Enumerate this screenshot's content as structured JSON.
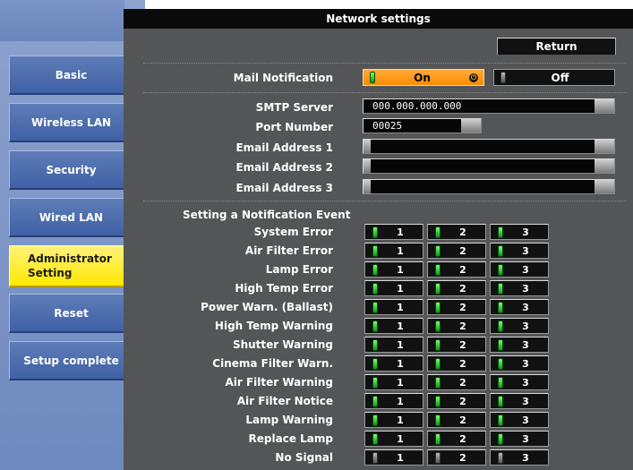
{
  "window": {
    "title": "Network settings"
  },
  "sidebar": {
    "items": [
      {
        "label": "Basic"
      },
      {
        "label": "Wireless LAN"
      },
      {
        "label": "Security"
      },
      {
        "label": "Wired LAN"
      },
      {
        "label": "Administrator Setting",
        "line1": "Administrator",
        "line2": "Setting",
        "active": true
      },
      {
        "label": "Reset"
      },
      {
        "label": "Setup complete"
      }
    ]
  },
  "header": {
    "return_label": "Return"
  },
  "mail": {
    "label": "Mail Notification",
    "on_label": "On",
    "off_label": "Off",
    "selected": "On"
  },
  "fields": {
    "smtp_label": "SMTP Server",
    "smtp_value": "000.000.000.000",
    "port_label": "Port Number",
    "port_value": "00025",
    "email1_label": "Email Address 1",
    "email1_value": "",
    "email2_label": "Email Address 2",
    "email2_value": "",
    "email3_label": "Email Address 3",
    "email3_value": ""
  },
  "events": {
    "heading": "Setting a Notification Event",
    "columns": [
      "1",
      "2",
      "3"
    ],
    "rows": [
      {
        "label": "System Error",
        "enabled": true
      },
      {
        "label": "Air Filter Error",
        "enabled": true
      },
      {
        "label": "Lamp Error",
        "enabled": true
      },
      {
        "label": "High Temp Error",
        "enabled": true
      },
      {
        "label": "Power Warn. (Ballast)",
        "enabled": true
      },
      {
        "label": "High Temp Warning",
        "enabled": true
      },
      {
        "label": "Shutter Warning",
        "enabled": true
      },
      {
        "label": "Cinema Filter Warn.",
        "enabled": true
      },
      {
        "label": "Air Filter Warning",
        "enabled": true
      },
      {
        "label": "Air Filter Notice",
        "enabled": true
      },
      {
        "label": "Lamp Warning",
        "enabled": true
      },
      {
        "label": "Replace Lamp",
        "enabled": true
      },
      {
        "label": "No Signal",
        "enabled": false
      }
    ]
  },
  "colors": {
    "sidebar_button": "#4a6aad",
    "active_button": "#ffe800",
    "on_toggle": "#ff8a00",
    "panel": "#535556",
    "led_on": "#23c22a"
  }
}
